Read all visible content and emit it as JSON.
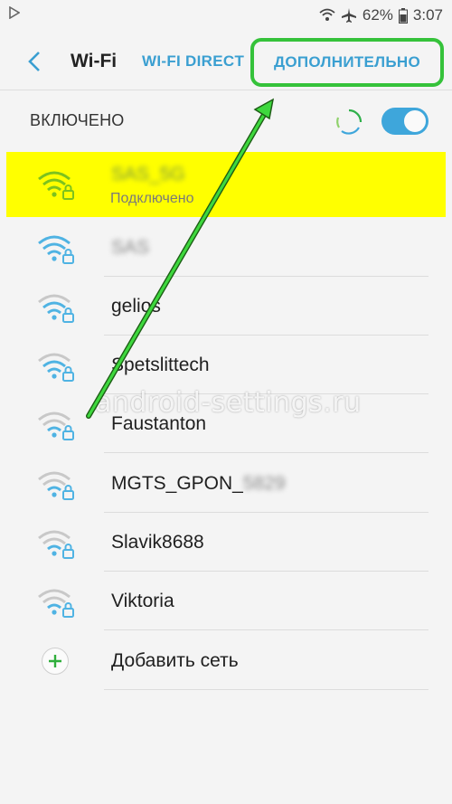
{
  "status_bar": {
    "battery": "62%",
    "time": "3:07"
  },
  "header": {
    "title": "Wi-Fi",
    "tab_direct": "WI-FI DIRECT",
    "tab_advanced": "ДОПОЛНИТЕЛЬНО"
  },
  "switch": {
    "label": "ВКЛЮЧЕНО",
    "on": true
  },
  "networks": [
    {
      "name": "SAS_5G",
      "status": "Подключено",
      "connected": true
    },
    {
      "name": "SAS"
    },
    {
      "name": "gelios"
    },
    {
      "name": "Spetslittech"
    },
    {
      "name": "Faustanton"
    },
    {
      "name": "MGTS_GPON_",
      "hidden_suffix": "5829"
    },
    {
      "name": "Slavik8688"
    },
    {
      "name": "Viktoria"
    }
  ],
  "add_network": {
    "label": "Добавить сеть"
  },
  "watermark": "android-settings.ru",
  "colors": {
    "accent": "#3a9fd1",
    "highlight": "#ffff00",
    "annotation": "#35c23a",
    "connected_icon": "#7cc21e"
  }
}
